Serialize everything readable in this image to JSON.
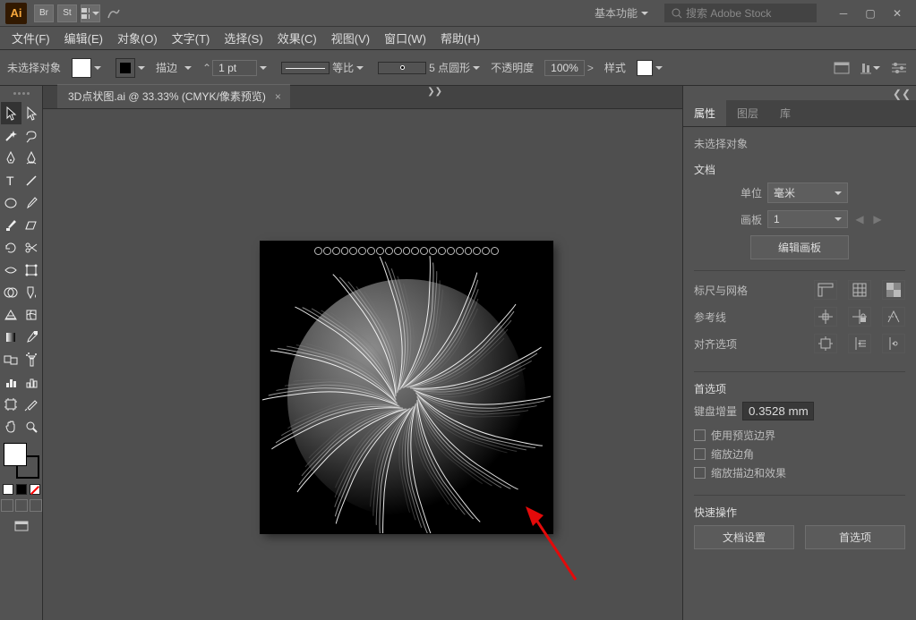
{
  "titlebar": {
    "bridge_abbrev": "Br",
    "stock_abbrev": "St",
    "workspace_label": "基本功能",
    "search_placeholder": "搜索 Adobe Stock"
  },
  "menubar": {
    "items": [
      "文件(F)",
      "编辑(E)",
      "对象(O)",
      "文字(T)",
      "选择(S)",
      "效果(C)",
      "视图(V)",
      "窗口(W)",
      "帮助(H)"
    ]
  },
  "controlbar": {
    "no_selection": "未选择对象",
    "stroke_label": "描边",
    "stroke_weight": "1 pt",
    "uniform_label": "等比",
    "dot_label": "5 点圆形",
    "opacity_label": "不透明度",
    "opacity_value": "100%",
    "style_label": "样式"
  },
  "document": {
    "tab_title": "3D点状图.ai @ 33.33% (CMYK/像素预览)"
  },
  "panels": {
    "tabs": {
      "properties": "属性",
      "layers": "图层",
      "libraries": "库"
    },
    "no_selection": "未选择对象",
    "doc_section": "文档",
    "units_label": "单位",
    "units_value": "毫米",
    "artboard_label": "画板",
    "artboard_value": "1",
    "edit_artboards": "编辑画板",
    "rulers_grid": "标尺与网格",
    "guides": "参考线",
    "align_options": "对齐选项",
    "prefs": "首选项",
    "key_increment_label": "键盘增量",
    "key_increment_value": "0.3528 mm",
    "chk_preview_bounds": "使用预览边界",
    "chk_scale_corners": "缩放边角",
    "chk_scale_strokes": "缩放描边和效果",
    "quick_actions": "快速操作",
    "doc_setup_btn": "文档设置",
    "prefs_btn": "首选项"
  }
}
